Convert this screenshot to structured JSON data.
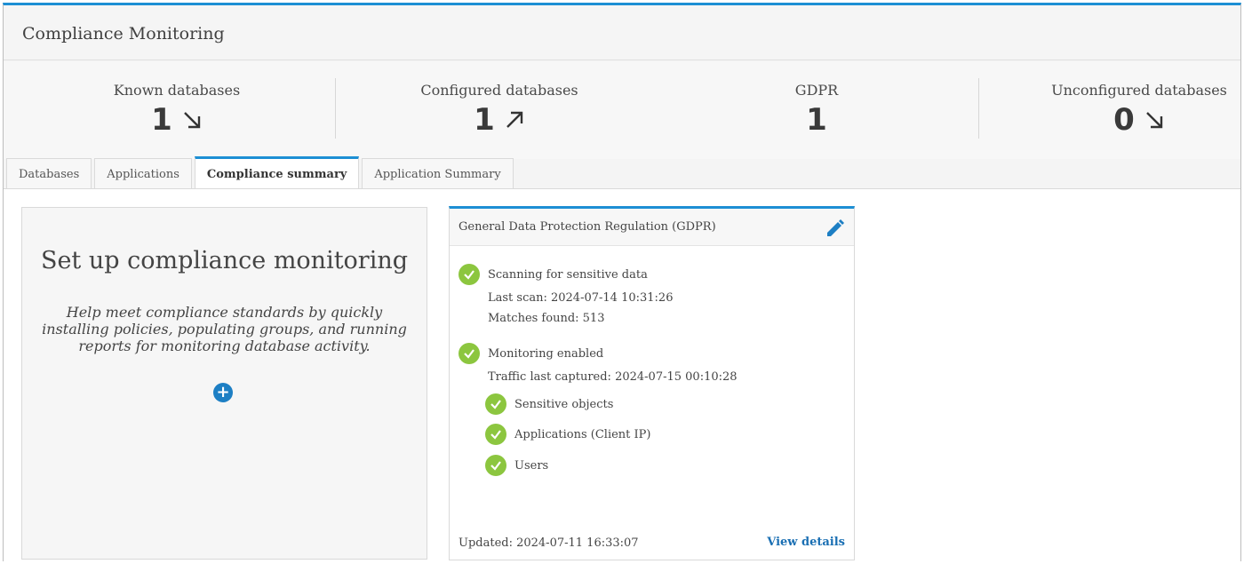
{
  "header": {
    "title": "Compliance Monitoring"
  },
  "stats": [
    {
      "label": "Known databases",
      "value": "1",
      "trend_icon": "arrow-down-right-icon"
    },
    {
      "label": "Configured databases",
      "value": "1",
      "trend_icon": "arrow-up-right-icon"
    },
    {
      "label": "GDPR",
      "value": "1",
      "trend_icon": ""
    },
    {
      "label": "Unconfigured databases",
      "value": "0",
      "trend_icon": "arrow-down-right-icon"
    }
  ],
  "tabs": [
    {
      "label": "Databases",
      "active": false
    },
    {
      "label": "Applications",
      "active": false
    },
    {
      "label": "Compliance summary",
      "active": true
    },
    {
      "label": "Application Summary",
      "active": false
    }
  ],
  "setup": {
    "title": "Set up compliance monitoring",
    "description": "Help meet compliance standards by quickly installing policies, populating groups, and running reports for monitoring database activity.",
    "add_icon": "plus-circle-icon"
  },
  "gdpr": {
    "title": "General Data Protection Regulation (GDPR)",
    "edit_icon": "pencil-icon",
    "scanning_label": "Scanning for sensitive data",
    "last_scan": "Last scan: 2024-07-14 10:31:26",
    "matches": "Matches found: 513",
    "monitoring_label": "Monitoring enabled",
    "traffic": "Traffic last captured: 2024-07-15 00:10:28",
    "sub_items": [
      "Sensitive objects",
      "Applications (Client IP)",
      "Users"
    ],
    "updated": "Updated: 2024-07-11 16:33:07",
    "view_details": "View details"
  },
  "colors": {
    "accent": "#1d8fd4",
    "success": "#8cc63f",
    "link": "#1a6fb3"
  }
}
